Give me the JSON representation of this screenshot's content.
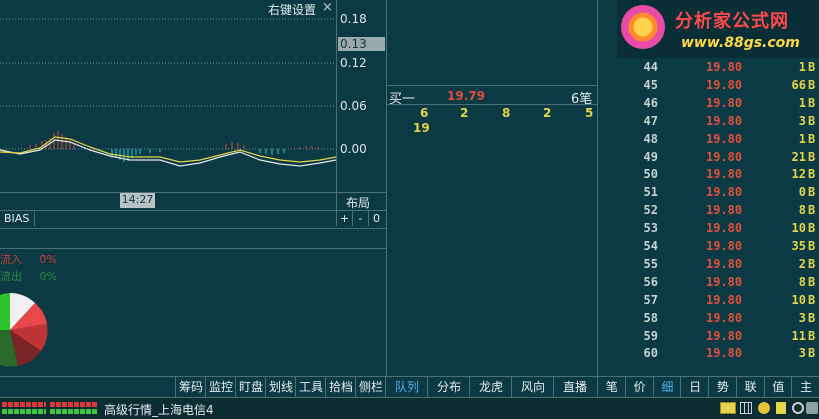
{
  "chart_panel": {
    "menu_label": "右键设置",
    "close_glyph": "×",
    "axis": [
      "0.18",
      "0.13",
      "0.12",
      "0.06",
      "0.00"
    ],
    "current_value": "0.13",
    "time_label": "14:27",
    "layout_label": "布局",
    "indicator_label": "BIAS",
    "plus_label": "+",
    "minus_label": "-",
    "zero_label": "0",
    "fund_in_label": "流入",
    "fund_in_value": "0%",
    "fund_out_label": "流出",
    "fund_out_value": "0%"
  },
  "queue_panel": {
    "side_label": "买一",
    "price": "19.79",
    "count": "6笔",
    "orders": [
      "6",
      "2",
      "8",
      "2",
      "5",
      "19"
    ]
  },
  "logo": {
    "title": "分析家公式网",
    "url": "www.88gs.com"
  },
  "ticks": [
    {
      "idx": "44",
      "price": "19.80",
      "vol": "1",
      "dir": "B"
    },
    {
      "idx": "45",
      "price": "19.80",
      "vol": "66",
      "dir": "B"
    },
    {
      "idx": "46",
      "price": "19.80",
      "vol": "1",
      "dir": "B"
    },
    {
      "idx": "47",
      "price": "19.80",
      "vol": "3",
      "dir": "B"
    },
    {
      "idx": "48",
      "price": "19.80",
      "vol": "1",
      "dir": "B"
    },
    {
      "idx": "49",
      "price": "19.80",
      "vol": "21",
      "dir": "B"
    },
    {
      "idx": "50",
      "price": "19.80",
      "vol": "12",
      "dir": "B"
    },
    {
      "idx": "51",
      "price": "19.80",
      "vol": "0",
      "dir": "B"
    },
    {
      "idx": "52",
      "price": "19.80",
      "vol": "8",
      "dir": "B"
    },
    {
      "idx": "53",
      "price": "19.80",
      "vol": "10",
      "dir": "B"
    },
    {
      "idx": "54",
      "price": "19.80",
      "vol": "35",
      "dir": "B"
    },
    {
      "idx": "55",
      "price": "19.80",
      "vol": "2",
      "dir": "B"
    },
    {
      "idx": "56",
      "price": "19.80",
      "vol": "8",
      "dir": "B"
    },
    {
      "idx": "57",
      "price": "19.80",
      "vol": "10",
      "dir": "B"
    },
    {
      "idx": "58",
      "price": "19.80",
      "vol": "3",
      "dir": "B"
    },
    {
      "idx": "59",
      "price": "19.80",
      "vol": "11",
      "dir": "B"
    },
    {
      "idx": "60",
      "price": "19.80",
      "vol": "3",
      "dir": "B"
    }
  ],
  "tabs": {
    "left": [
      "筹码",
      "监控",
      "盯盘",
      "划线",
      "工具",
      "拾档",
      "侧栏"
    ],
    "mid": [
      "队列",
      "分布",
      "龙虎",
      "风向",
      "直播"
    ],
    "right": [
      "笔",
      "价",
      "细",
      "日",
      "势",
      "联",
      "值",
      "主"
    ]
  },
  "status": {
    "connection": "高级行情_上海电信4"
  },
  "colors": {
    "background": "#0c3a44",
    "red": "#e0503c",
    "yellow": "#e6d44a",
    "active_tab": "#4fb0f0"
  }
}
